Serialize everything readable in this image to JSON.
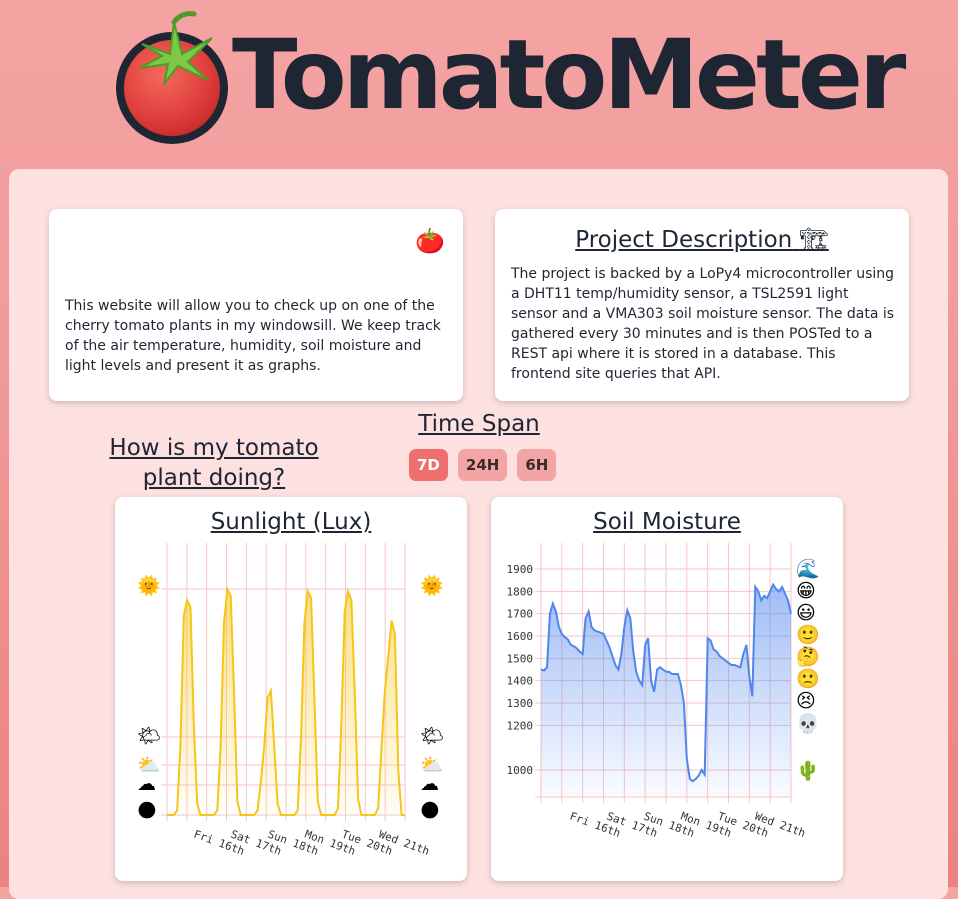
{
  "app": {
    "logo_text": "TomatoMeter"
  },
  "cards": {
    "how": {
      "title": "How is my tomato plant doing?",
      "emoji": "🍅",
      "text": "This website will allow you to check up on one of the cherry tomato plants in my windowsill. We keep track of the air temperature, humidity, soil moisture and light levels and present it as graphs."
    },
    "project": {
      "title": "Project Description",
      "emoji": "🏗",
      "text": "The project is backed by a LoPy4 microcontroller using a DHT11 temp/humidity sensor, a TSL2591 light sensor and a VMA303 soil moisture sensor. The data is gathered every 30 minutes and is then POSTed to a REST api where it is stored in a database. This frontend site queries that API."
    }
  },
  "timespan": {
    "title": "Time Span",
    "buttons": [
      "7D",
      "24H",
      "6H"
    ],
    "selected": "7D"
  },
  "chart_data": [
    {
      "type": "area",
      "title": "Sunlight (Lux)",
      "x_tick_labels": [
        "Fri 16th",
        "Sat 17th",
        "Sun 18th",
        "Mon 19th",
        "Tue 20th",
        "Wed 21th"
      ],
      "y_scale": "log",
      "grid": true,
      "series": [
        {
          "color": "#f5c518",
          "daily_peaks": [
            0.97,
            1.0,
            0.55,
            0.99,
            0.99,
            0.86
          ],
          "values": [
            0.0,
            0.0,
            0.0,
            0.02,
            0.3,
            0.88,
            0.95,
            0.92,
            0.4,
            0.05,
            0.0,
            0.0,
            0.0,
            0.0,
            0.0,
            0.02,
            0.3,
            0.85,
            1.0,
            0.97,
            0.55,
            0.06,
            0.0,
            0.0,
            0.0,
            0.0,
            0.0,
            0.02,
            0.15,
            0.3,
            0.52,
            0.55,
            0.3,
            0.05,
            0.0,
            0.0,
            0.0,
            0.0,
            0.0,
            0.02,
            0.35,
            0.85,
            0.99,
            0.96,
            0.5,
            0.06,
            0.0,
            0.0,
            0.0,
            0.0,
            0.0,
            0.03,
            0.4,
            0.9,
            0.99,
            0.95,
            0.55,
            0.07,
            0.0,
            0.0,
            0.0,
            0.0,
            0.0,
            0.03,
            0.3,
            0.55,
            0.7,
            0.86,
            0.8,
            0.2,
            0.0,
            0.0
          ]
        }
      ],
      "side_icons": [
        "🌞",
        "🌤",
        "⛅",
        "☁",
        "🌑"
      ],
      "colors": {
        "grid": "#f7c6c6",
        "line": "#f5c518"
      }
    },
    {
      "type": "area",
      "title": "Soil Moisture",
      "x_tick_labels": [
        "Fri 16th",
        "Sat 17th",
        "Sun 18th",
        "Mon 19th",
        "Tue 20th",
        "Wed 21th"
      ],
      "y_ticks": [
        1900,
        1800,
        1700,
        1600,
        1500,
        1400,
        1300,
        1200,
        1000
      ],
      "ylim": [
        920,
        1960
      ],
      "grid": true,
      "series": [
        {
          "color": "#4f86ee",
          "values": [
            1450,
            1445,
            1460,
            1700,
            1745,
            1710,
            1640,
            1610,
            1595,
            1585,
            1560,
            1555,
            1545,
            1530,
            1520,
            1680,
            1710,
            1640,
            1625,
            1620,
            1615,
            1610,
            1580,
            1550,
            1510,
            1470,
            1450,
            1520,
            1640,
            1715,
            1680,
            1530,
            1440,
            1400,
            1380,
            1560,
            1590,
            1400,
            1350,
            1450,
            1460,
            1450,
            1440,
            1440,
            1430,
            1430,
            1430,
            1380,
            1300,
            1050,
            960,
            950,
            960,
            975,
            1000,
            980,
            1590,
            1580,
            1540,
            1530,
            1510,
            1500,
            1490,
            1480,
            1470,
            1470,
            1465,
            1460,
            1520,
            1560,
            1420,
            1330,
            1820,
            1800,
            1760,
            1780,
            1770,
            1800,
            1830,
            1810,
            1800,
            1820,
            1790,
            1760,
            1700
          ]
        }
      ],
      "side_icons": [
        "🌊",
        "😁",
        "😃",
        "🙂",
        "🤔",
        "🙁",
        "😣",
        "💀",
        "🌵"
      ],
      "colors": {
        "grid": "#f7c6c6",
        "line": "#4f86ee"
      }
    }
  ]
}
